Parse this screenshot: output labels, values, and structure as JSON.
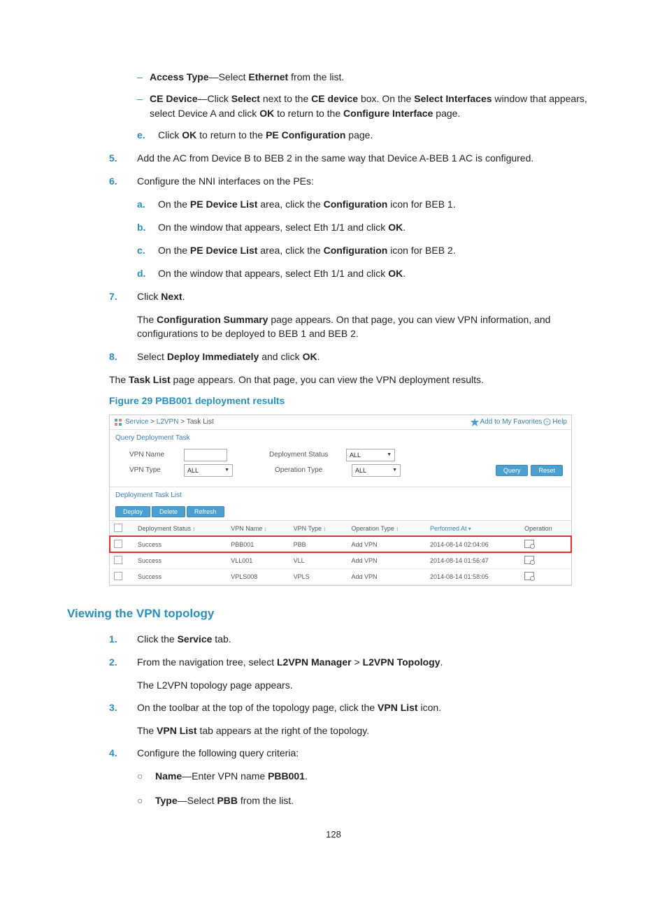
{
  "doc": {
    "dash_items": [
      {
        "pre": "Access Type",
        "mid": "—Select ",
        "bold2": "Ethernet",
        "post": " from the list."
      },
      {
        "pre": "CE Device",
        "mid": "—Click ",
        "bold2": "Select",
        "post1": " next to the ",
        "bold3": "CE device",
        "post2": " box. On the ",
        "bold4": "Select Interfaces",
        "post3": " window that appears, select Device A and click ",
        "bold5": "OK",
        "post4": " to return to the ",
        "bold6": "Configure Interface",
        "post5": " page."
      }
    ],
    "step_e": {
      "letter": "e.",
      "pre": "Click ",
      "b1": "OK",
      "mid": " to return to the ",
      "b2": "PE Configuration",
      "post": " page."
    },
    "step5": {
      "num": "5.",
      "text": "Add the AC from Device B to BEB 2 in the same way that Device A-BEB 1 AC is configured."
    },
    "step6": {
      "num": "6.",
      "text": "Configure the NNI interfaces on the PEs:"
    },
    "step6_letters": [
      {
        "letter": "a.",
        "pre": "On the ",
        "b1": "PE Device List",
        "mid": " area, click the ",
        "b2": "Configuration",
        "post": " icon for BEB 1."
      },
      {
        "letter": "b.",
        "pre": "On the window that appears, select Eth 1/1 and click ",
        "b1": "OK",
        "post": "."
      },
      {
        "letter": "c.",
        "pre": "On the ",
        "b1": "PE Device List",
        "mid": " area, click the ",
        "b2": "Configuration",
        "post": " icon for BEB 2."
      },
      {
        "letter": "d.",
        "pre": "On the window that appears, select Eth 1/1 and click ",
        "b1": "OK",
        "post": "."
      }
    ],
    "step7": {
      "num": "7.",
      "pre": "Click ",
      "b1": "Next",
      "post": "."
    },
    "step7_body": {
      "pre": "The ",
      "b1": "Configuration Summary",
      "post": " page appears. On that page, you can view VPN information, and configurations to be deployed to BEB 1 and BEB 2."
    },
    "step8": {
      "num": "8.",
      "pre": "Select ",
      "b1": "Deploy Immediately",
      "mid": " and click ",
      "b2": "OK",
      "post": "."
    },
    "tasklist_para": {
      "pre": "The ",
      "b1": "Task List",
      "post": " page appears. On that page, you can view the VPN deployment results."
    },
    "fig_caption": "Figure 29 PBB001 deployment results",
    "heading_topology": "Viewing the VPN topology",
    "topo_steps": [
      {
        "num": "1.",
        "pre": "Click the ",
        "b1": "Service",
        "post": " tab."
      },
      {
        "num": "2.",
        "pre": "From the navigation tree, select ",
        "b1": "L2VPN Manager",
        "mid": " > ",
        "b2": "L2VPN Topology",
        "post": "."
      },
      {
        "num": "3.",
        "pre": "On the toolbar at the top of the topology page, click the ",
        "b1": "VPN List",
        "post": " icon."
      },
      {
        "num": "4.",
        "text": "Configure the following query criteria:"
      }
    ],
    "topo_body2": "The L2VPN topology page appears.",
    "topo_body3": {
      "pre": "The ",
      "b1": "VPN List",
      "post": " tab appears at the right of the topology."
    },
    "circle_items": [
      {
        "b1": "Name",
        "mid": "—Enter VPN name ",
        "b2": "PBB001",
        "post": "."
      },
      {
        "b1": "Type",
        "mid": "—Select ",
        "b2": "PBB",
        "post": " from the list."
      }
    ],
    "page_number": "128"
  },
  "screenshot": {
    "crumb": {
      "service": "Service",
      "l2vpn": "L2VPN",
      "tasklist": "Task List"
    },
    "fav": "Add to My Favorites",
    "help": "Help",
    "panel1": "Query Deployment Task",
    "labels": {
      "vpnname": "VPN Name",
      "vpntype": "VPN Type",
      "depstatus": "Deployment Status",
      "optype": "Operation Type"
    },
    "all": "ALL",
    "query_btn": "Query",
    "reset_btn": "Reset",
    "panel2": "Deployment Task List",
    "btns": {
      "deploy": "Deploy",
      "delete": "Delete",
      "refresh": "Refresh"
    },
    "cols": {
      "dep": "Deployment Status",
      "vpnname": "VPN Name",
      "vpntype": "VPN Type",
      "optype": "Operation Type",
      "perf": "Performed At",
      "op": "Operation"
    },
    "rows": [
      {
        "status": "Success",
        "name": "PBB001",
        "type": "PBB",
        "op": "Add VPN",
        "at": "2014-08-14 02:04:06"
      },
      {
        "status": "Success",
        "name": "VLL001",
        "type": "VLL",
        "op": "Add VPN",
        "at": "2014-08-14 01:56:47"
      },
      {
        "status": "Success",
        "name": "VPLS008",
        "type": "VPLS",
        "op": "Add VPN",
        "at": "2014-08-14 01:58:05"
      }
    ]
  }
}
